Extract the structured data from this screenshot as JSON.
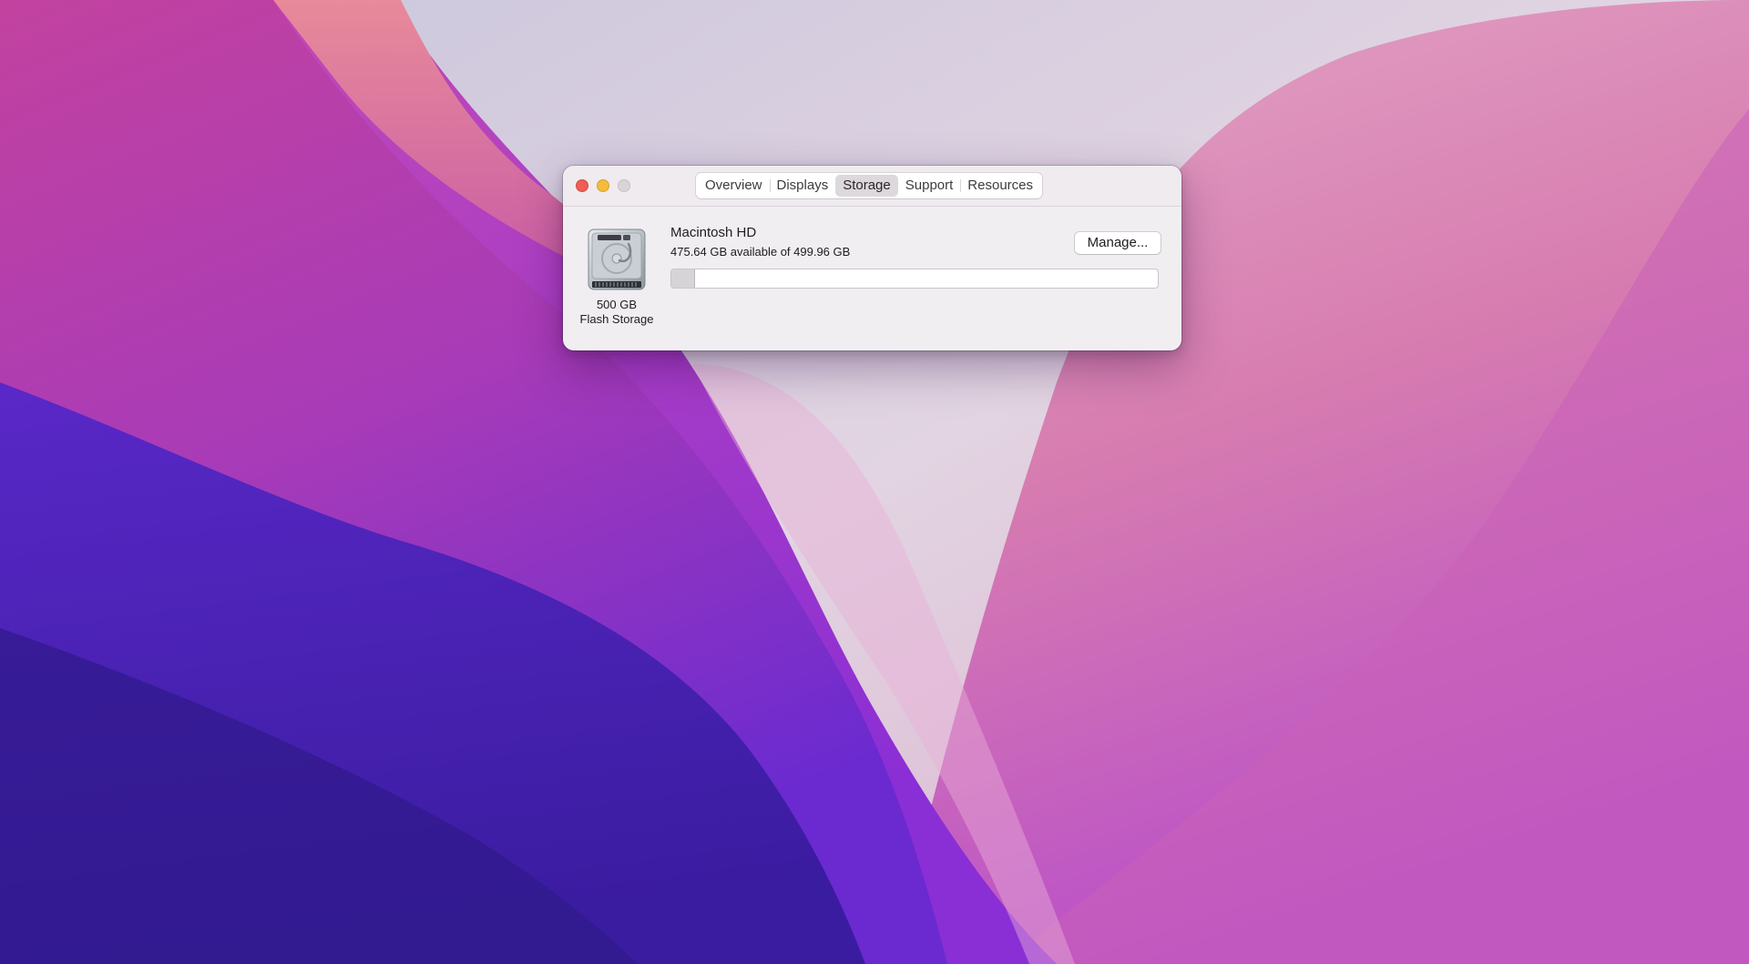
{
  "window": {
    "tabs": [
      {
        "label": "Overview",
        "selected": false
      },
      {
        "label": "Displays",
        "selected": false
      },
      {
        "label": "Storage",
        "selected": true
      },
      {
        "label": "Support",
        "selected": false
      },
      {
        "label": "Resources",
        "selected": false
      }
    ],
    "traffic_lights": {
      "close_color": "#ee5e55",
      "minimize_color": "#f4bc3c",
      "zoom_color": "#d8d5d9"
    }
  },
  "storage": {
    "drive_icon": "hard-drive-icon",
    "capacity_label": "500 GB",
    "type_label": "Flash Storage",
    "volume_name": "Macintosh HD",
    "availability": "475.64 GB available of 499.96 GB",
    "manage_label": "Manage...",
    "used_fraction": 0.0487
  }
}
